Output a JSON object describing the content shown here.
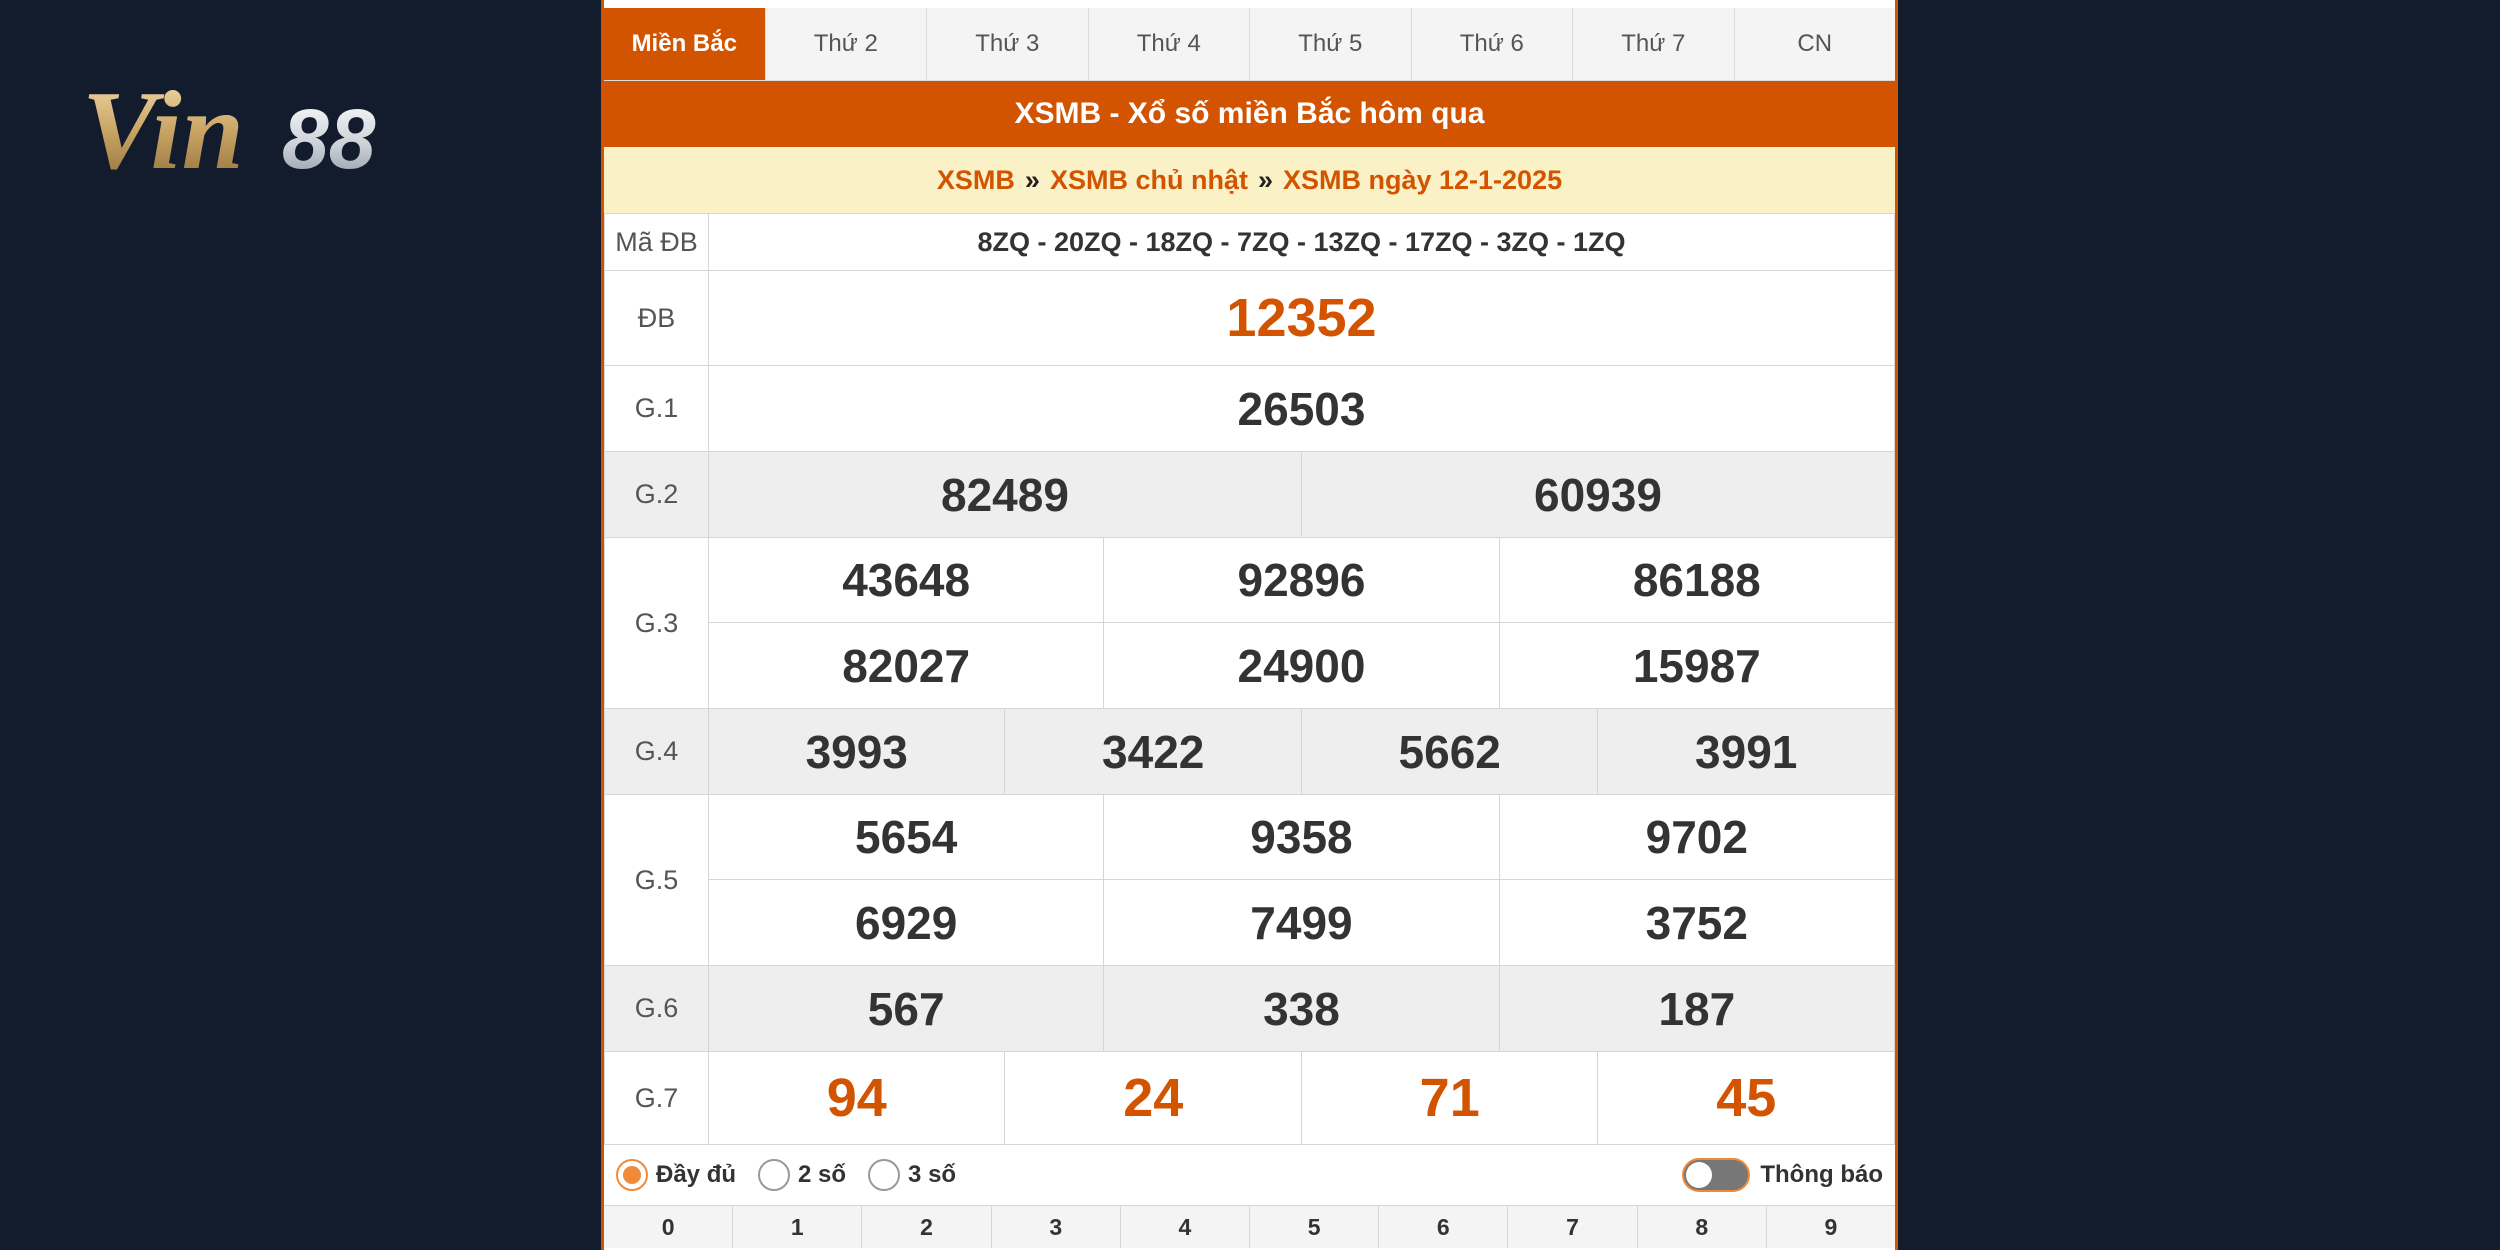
{
  "logo": {
    "text_a": "Vin",
    "text_b": "88"
  },
  "tabs": [
    "Miền Bắc",
    "Thứ 2",
    "Thứ 3",
    "Thứ 4",
    "Thứ 5",
    "Thứ 6",
    "Thứ 7",
    "CN"
  ],
  "title": "XSMB - Xổ số miền Bắc hôm qua",
  "breadcrumb": {
    "items": [
      "XSMB",
      "XSMB chủ nhật",
      "XSMB ngày 12-1-2025"
    ],
    "sep": "»"
  },
  "ma_db": {
    "label": "Mã ĐB",
    "value": "8ZQ - 20ZQ - 18ZQ - 7ZQ - 13ZQ - 17ZQ - 3ZQ - 1ZQ"
  },
  "prizes": {
    "db": {
      "label": "ĐB",
      "numbers": [
        "12352"
      ]
    },
    "g1": {
      "label": "G.1",
      "numbers": [
        "26503"
      ]
    },
    "g2": {
      "label": "G.2",
      "numbers": [
        "82489",
        "60939"
      ]
    },
    "g3": {
      "label": "G.3",
      "numbers": [
        "43648",
        "92896",
        "86188",
        "82027",
        "24900",
        "15987"
      ]
    },
    "g4": {
      "label": "G.4",
      "numbers": [
        "3993",
        "3422",
        "5662",
        "3991"
      ]
    },
    "g5": {
      "label": "G.5",
      "numbers": [
        "5654",
        "9358",
        "9702",
        "6929",
        "7499",
        "3752"
      ]
    },
    "g6": {
      "label": "G.6",
      "numbers": [
        "567",
        "338",
        "187"
      ]
    },
    "g7": {
      "label": "G.7",
      "numbers": [
        "94",
        "24",
        "71",
        "45"
      ]
    }
  },
  "options": {
    "full": "Đầy đủ",
    "two": "2 số",
    "three": "3 số",
    "notify": "Thông báo"
  },
  "digits": [
    "0",
    "1",
    "2",
    "3",
    "4",
    "5",
    "6",
    "7",
    "8",
    "9"
  ],
  "colors": {
    "accent": "#d35400",
    "code_blue": "#1a62b0",
    "background": "#121c2d"
  }
}
